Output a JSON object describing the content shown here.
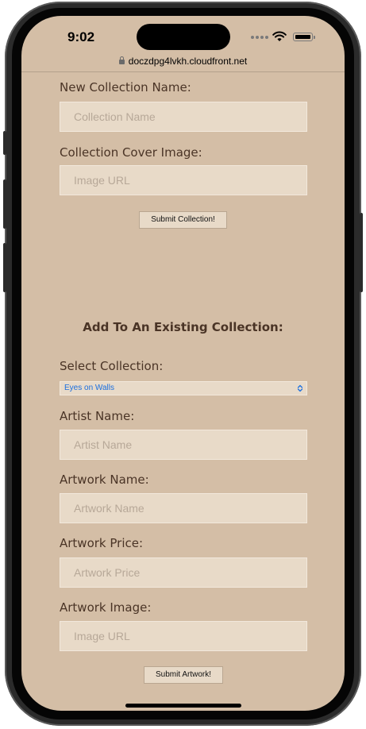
{
  "status_bar": {
    "time": "9:02"
  },
  "browser": {
    "url": "doczdpg4lvkh.cloudfront.net"
  },
  "new_collection": {
    "name_label": "New Collection Name:",
    "name_placeholder": "Collection Name",
    "cover_label": "Collection Cover Image:",
    "cover_placeholder": "Image URL",
    "submit_label": "Submit Collection!"
  },
  "existing_collection": {
    "heading": "Add To An Existing Collection:",
    "select_label": "Select Collection:",
    "selected_collection": "Eyes on Walls",
    "artist_label": "Artist Name:",
    "artist_placeholder": "Artist Name",
    "artwork_name_label": "Artwork Name:",
    "artwork_name_placeholder": "Artwork Name",
    "price_label": "Artwork Price:",
    "price_placeholder": "Artwork Price",
    "image_label": "Artwork Image:",
    "image_placeholder": "Image URL",
    "submit_label": "Submit Artwork!"
  },
  "colors": {
    "page_background": "#d4bea6",
    "field_background": "#e8dac8",
    "text": "#4a3426",
    "select_text": "#1a6fe0"
  }
}
